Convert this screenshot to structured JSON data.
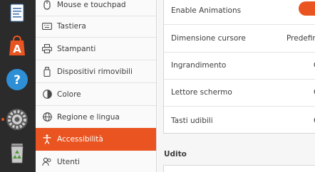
{
  "dock": {
    "items": [
      {
        "name": "document-viewer-icon"
      },
      {
        "name": "software-center-icon"
      },
      {
        "name": "help-icon"
      },
      {
        "name": "settings-icon"
      },
      {
        "name": "trash-icon"
      }
    ]
  },
  "sidebar": {
    "items": [
      {
        "label": "Mouse e touchpad",
        "icon": "mouse-icon"
      },
      {
        "label": "Tastiera",
        "icon": "keyboard-icon"
      },
      {
        "label": "Stampanti",
        "icon": "printer-icon"
      },
      {
        "label": "Dispositivi rimovibili",
        "icon": "removable-media-icon"
      },
      {
        "label": "Colore",
        "icon": "color-icon"
      },
      {
        "label": "Regione e lingua",
        "icon": "globe-icon"
      },
      {
        "label": "Accessibilità",
        "icon": "accessibility-icon",
        "active": true
      },
      {
        "label": "Utenti",
        "icon": "users-icon"
      }
    ]
  },
  "main": {
    "rows": [
      {
        "label": "Enable Animations",
        "toggle_on": true
      },
      {
        "label": "Dimensione cursore",
        "value": "Predefin"
      },
      {
        "label": "Ingrandimento",
        "value": "O"
      },
      {
        "label": "Lettore schermo",
        "value": "O"
      },
      {
        "label": "Tasti udibili",
        "value": "O"
      }
    ],
    "section_title": "Udito"
  },
  "colors": {
    "accent": "#e95420",
    "dock": "#2b2b2b"
  }
}
